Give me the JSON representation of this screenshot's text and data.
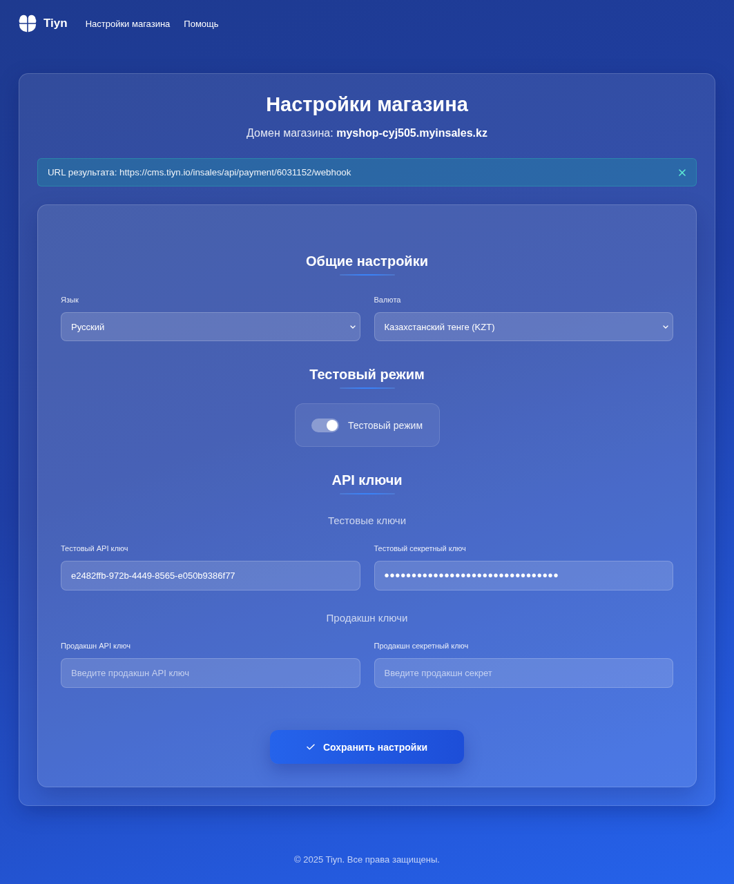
{
  "header": {
    "brand": "Tiyn",
    "nav": [
      {
        "label": "Настройки магазина"
      },
      {
        "label": "Помощь"
      }
    ]
  },
  "page": {
    "title": "Настройки магазина",
    "domain": "Домен магазина: **myshop-cyj505.myinsales.kz**"
  },
  "alert": {
    "text": "URL результата: https://cms.tiyn.io/insales/api/payment/6031152/webhook"
  },
  "sections": [
    {
      "kind": "fields",
      "title": "Общие настройки",
      "fields": [
        {
          "kind": "select",
          "label": "Язык",
          "value": "Русский"
        },
        {
          "kind": "select",
          "label": "Валюта",
          "value": "Казахстанский тенге (KZT)"
        }
      ]
    },
    {
      "kind": "toggle",
      "title": "Тестовый режим",
      "toggle": {
        "label": "Тестовый режим",
        "on": true
      }
    },
    {
      "kind": "key_groups",
      "title": "API ключи",
      "groups": [
        {
          "subtitle": "Тестовые ключи",
          "fields": [
            {
              "kind": "text",
              "label": "Тестовый API ключ",
              "value": "e2482ffb-972b-4449-8565-e050b9386f77"
            },
            {
              "kind": "secret",
              "label": "Тестовый секретный ключ",
              "value": "••••••••••••••••••••••••••••••••"
            }
          ]
        },
        {
          "subtitle": "Продакшн ключи",
          "fields": [
            {
              "kind": "text",
              "label": "Продакшн API ключ",
              "placeholder": "Введите продакшн API ключ"
            },
            {
              "kind": "secret",
              "label": "Продакшн секретный ключ",
              "placeholder": "Введите продакшн секрет"
            }
          ]
        }
      ]
    }
  ],
  "save_button": {
    "label": "Сохранить настройки"
  },
  "footer": {
    "text": "© 2025 Tiyn. Все права защищены."
  }
}
